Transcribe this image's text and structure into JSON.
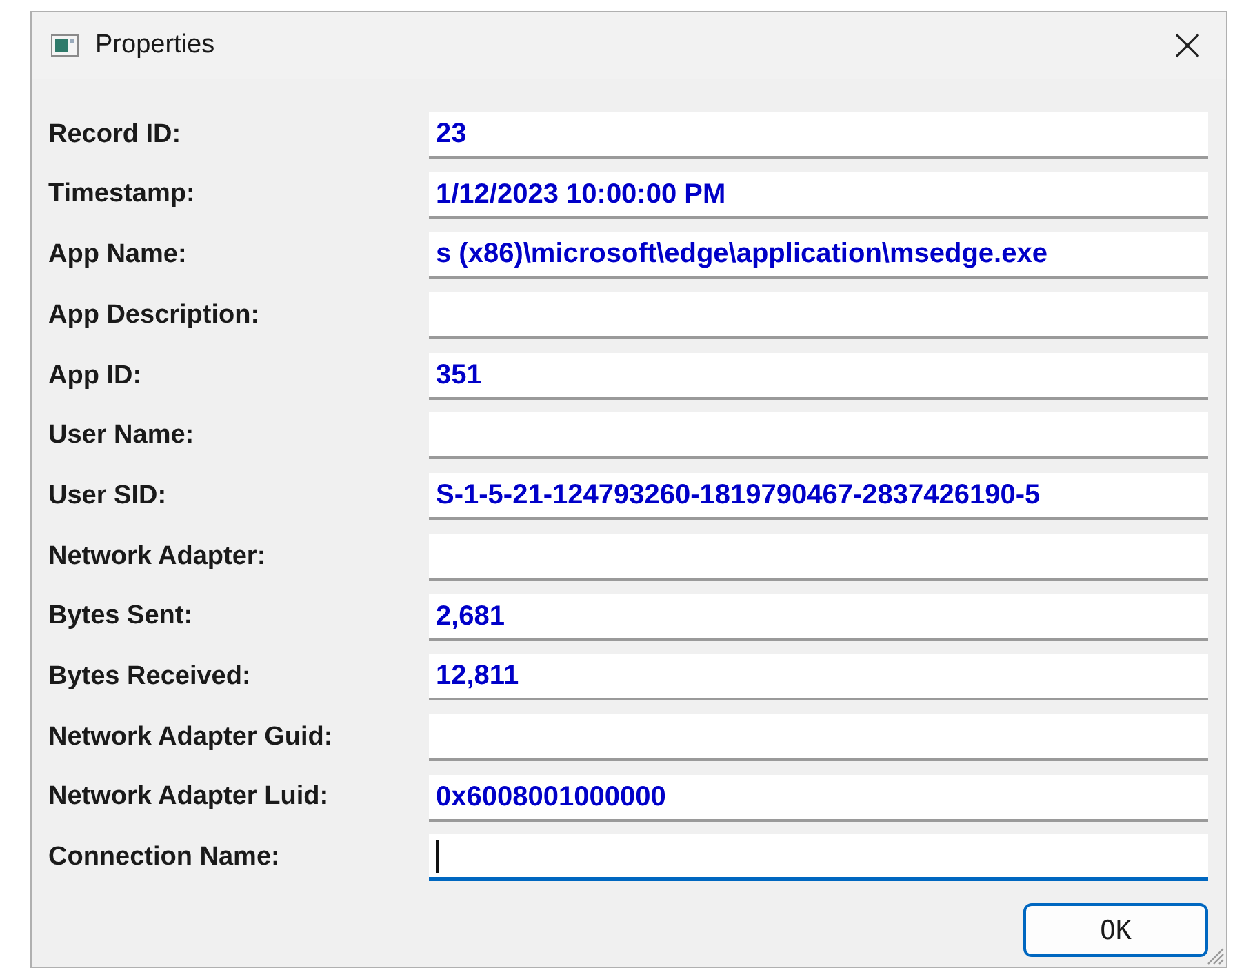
{
  "window": {
    "title": "Properties"
  },
  "fields": [
    {
      "label": "Record ID:",
      "value": "23",
      "focused": false
    },
    {
      "label": "Timestamp:",
      "value": "1/12/2023 10:00:00 PM",
      "focused": false
    },
    {
      "label": "App Name:",
      "value": "s (x86)\\microsoft\\edge\\application\\msedge.exe",
      "focused": false
    },
    {
      "label": "App Description:",
      "focused": false
    },
    {
      "label": "App ID:",
      "value": "351",
      "focused": false
    },
    {
      "label": "User Name:",
      "focused": false
    },
    {
      "label": "User SID:",
      "value": "S-1-5-21-124793260-1819790467-2837426190-5",
      "focused": false
    },
    {
      "label": "Network Adapter:",
      "focused": false
    },
    {
      "label": "Bytes Sent:",
      "value": "2,681",
      "focused": false
    },
    {
      "label": "Bytes Received:",
      "value": "12,811",
      "focused": false
    },
    {
      "label": "Network Adapter Guid:",
      "focused": false
    },
    {
      "label": "Network Adapter Luid:",
      "value": "0x6008001000000",
      "focused": false
    },
    {
      "label": "Connection Name:",
      "focused": true
    }
  ],
  "buttons": [
    "OK"
  ]
}
